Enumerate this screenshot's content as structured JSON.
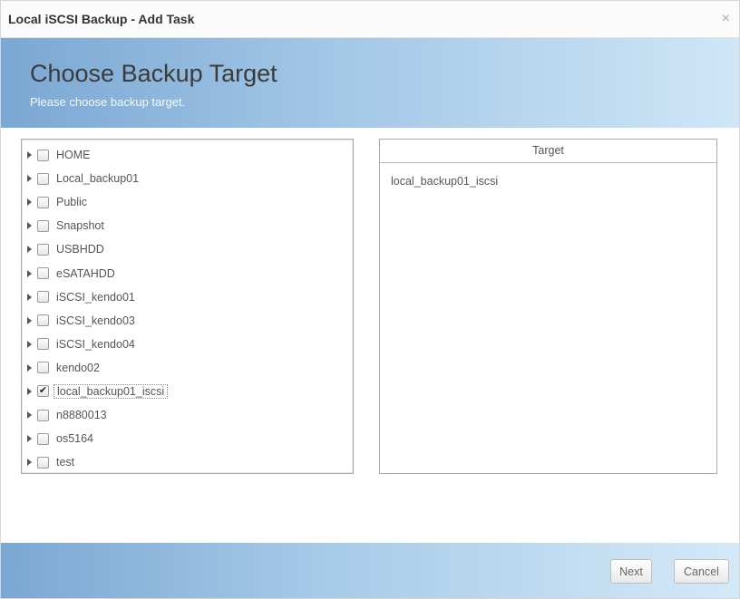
{
  "dialog": {
    "title": "Local iSCSI Backup - Add Task",
    "close_glyph": "×"
  },
  "header": {
    "title": "Choose Backup Target",
    "subtitle": "Please choose backup target."
  },
  "tree": {
    "items": [
      {
        "label": "HOME",
        "checked": false
      },
      {
        "label": "Local_backup01",
        "checked": false
      },
      {
        "label": "Public",
        "checked": false
      },
      {
        "label": "Snapshot",
        "checked": false
      },
      {
        "label": "USBHDD",
        "checked": false
      },
      {
        "label": "eSATAHDD",
        "checked": false
      },
      {
        "label": "iSCSI_kendo01",
        "checked": false
      },
      {
        "label": "iSCSI_kendo03",
        "checked": false
      },
      {
        "label": "iSCSI_kendo04",
        "checked": false
      },
      {
        "label": "kendo02",
        "checked": false
      },
      {
        "label": "local_backup01_iscsi",
        "checked": true
      },
      {
        "label": "n8880013",
        "checked": false
      },
      {
        "label": "os5164",
        "checked": false
      },
      {
        "label": "test",
        "checked": false
      }
    ]
  },
  "target": {
    "header": "Target",
    "items": [
      "local_backup01_iscsi"
    ]
  },
  "footer": {
    "next_label": "Next",
    "cancel_label": "Cancel"
  },
  "colors": {
    "header_gradient_start": "#7aa7d3",
    "header_gradient_end": "#cfe6f6"
  }
}
